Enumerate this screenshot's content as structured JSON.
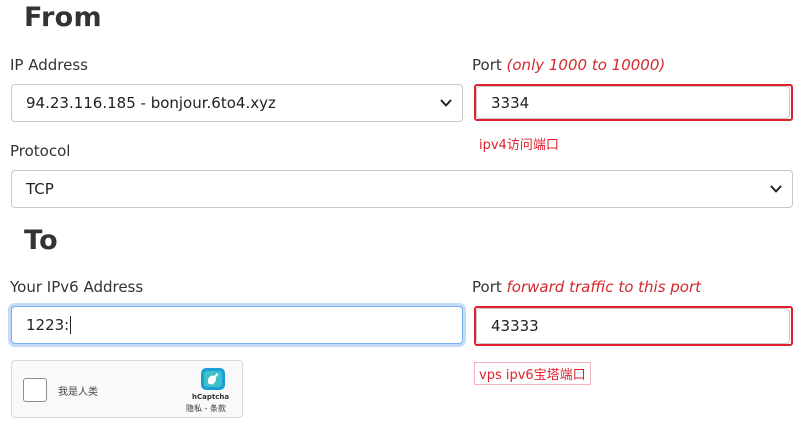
{
  "from": {
    "heading": "From",
    "ip": {
      "label": "IP Address",
      "value": "94.23.116.185 - bonjour.6to4.xyz"
    },
    "port": {
      "label": "Port",
      "hint": "(only 1000 to 10000)",
      "value": "3334",
      "annotation": "ipv4访问端口"
    },
    "protocol": {
      "label": "Protocol",
      "value": "TCP"
    }
  },
  "to": {
    "heading": "To",
    "ipv6": {
      "label": "Your IPv6 Address",
      "value": "1223:"
    },
    "port": {
      "label": "Port",
      "hint": "forward traffic to this port",
      "value": "43333",
      "annotation": "vps ipv6宝塔端口"
    }
  },
  "captcha": {
    "label": "我是人类",
    "brand": "hCaptcha",
    "links": "隐私 - 条款"
  },
  "colors": {
    "annotation_red": "#e0202c",
    "hint_red": "#d3292c",
    "focus_blue": "#7aaef0"
  }
}
